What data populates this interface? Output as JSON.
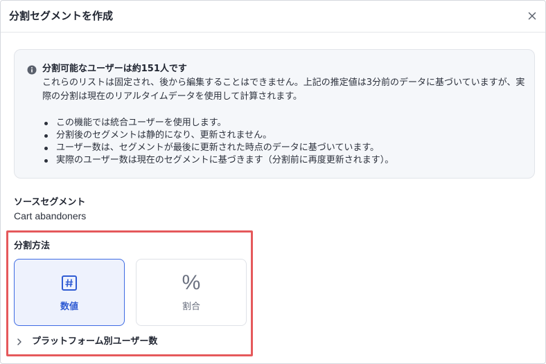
{
  "dialog": {
    "title": "分割セグメントを作成",
    "close_icon": "close-icon"
  },
  "info": {
    "icon": "info-icon",
    "title": "分割可能なユーザーは約151人です",
    "description": "これらのリストは固定され、後から編集することはできません。上記の推定値は3分前のデータに基づいていますが、実際の分割は現在のリアルタイムデータを使用して計算されます。",
    "bullets": [
      "この機能では統合ユーザーを使用します。",
      "分割後のセグメントは静的になり、更新されません。",
      "ユーザー数は、セグメントが最後に更新された時点のデータに基づいています。",
      "実際のユーザー数は現在のセグメントに基づきます（分割前に再度更新されます）。"
    ]
  },
  "source": {
    "label": "ソースセグメント",
    "value": "Cart abandoners"
  },
  "split_method": {
    "label": "分割方法",
    "options": [
      {
        "label": "数値",
        "icon": "hash-icon",
        "selected": true
      },
      {
        "label": "割合",
        "icon": "percent-icon",
        "selected": false
      }
    ]
  },
  "expander": {
    "label": "プラットフォーム別ユーザー数",
    "icon": "chevron-right-icon"
  },
  "colors": {
    "accent": "#2f5bd3",
    "highlight_border": "#e5595b",
    "info_bg": "#f5f7fa"
  }
}
